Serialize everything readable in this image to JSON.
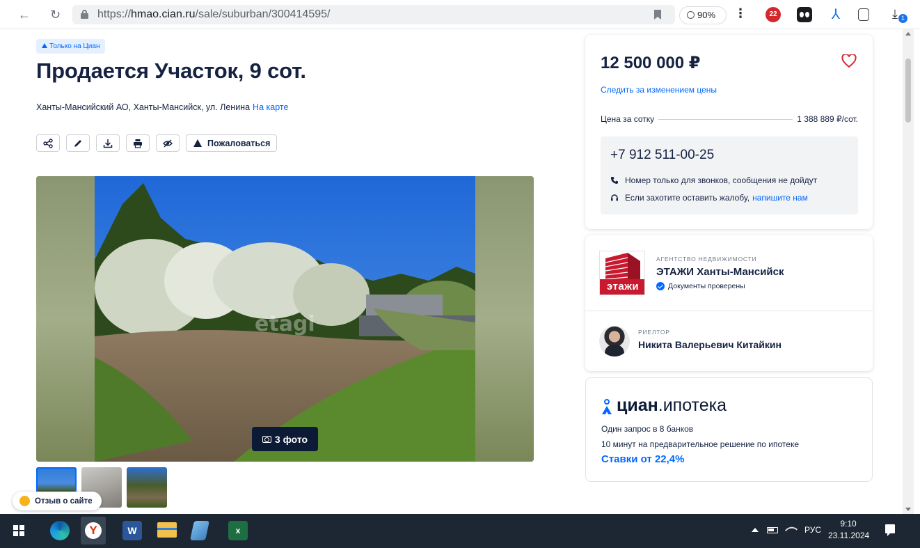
{
  "browser": {
    "url_prefix": "https://",
    "url_domain": "hmao.cian.ru",
    "url_path": "/sale/suburban/300414595/",
    "zoom": "90%",
    "ext_badge_count": "22",
    "download_badge": "1"
  },
  "listing": {
    "tag": "Только на Циан",
    "title": "Продается Участок, 9 сот.",
    "address": "Ханты-Мансийский АО, Ханты-Мансийск, ул. Ленина",
    "map_link": "На карте",
    "complain_label": "Пожаловаться",
    "photo_count": "3 фото",
    "photo_watermark": "etagi"
  },
  "price_card": {
    "price": "12 500 000 ₽",
    "follow_label": "Следить за изменением цены",
    "ppu_label": "Цена за сотку",
    "ppu_value": "1 388 889 ₽/сот.",
    "phone": "+7 912 511-00-25",
    "phone_note": "Номер только для звонков, сообщения не дойдут",
    "complaint_note": "Если захотите оставить жалобу,",
    "complaint_link": "напишите нам"
  },
  "agency": {
    "logo_text": "этажи",
    "type": "АГЕНТСТВО НЕДВИЖИМОСТИ",
    "name": "ЭТАЖИ Ханты-Мансийск",
    "verified": "Документы проверены",
    "realtor_type": "РИЕЛТОР",
    "realtor_name": "Никита Валерьевич Китайкин"
  },
  "mortgage": {
    "brand": "циан",
    "brand_sub": ".ипотека",
    "line1": "Один запрос в 8 банков",
    "line2": "10 минут на предварительное решение по ипотеке",
    "rate": "Ставки от 22,4%"
  },
  "feedback_label": "Отзыв о сайте",
  "taskbar": {
    "word_label": "W",
    "excel_label": "x",
    "lang": "РУС",
    "time": "9:10",
    "date": "23.11.2024"
  },
  "colors": {
    "accent": "#0468ff",
    "text": "#152242",
    "tag_bg": "#e5f0ff",
    "agency_red": "#c8192e",
    "taskbar": "#1d2733"
  }
}
